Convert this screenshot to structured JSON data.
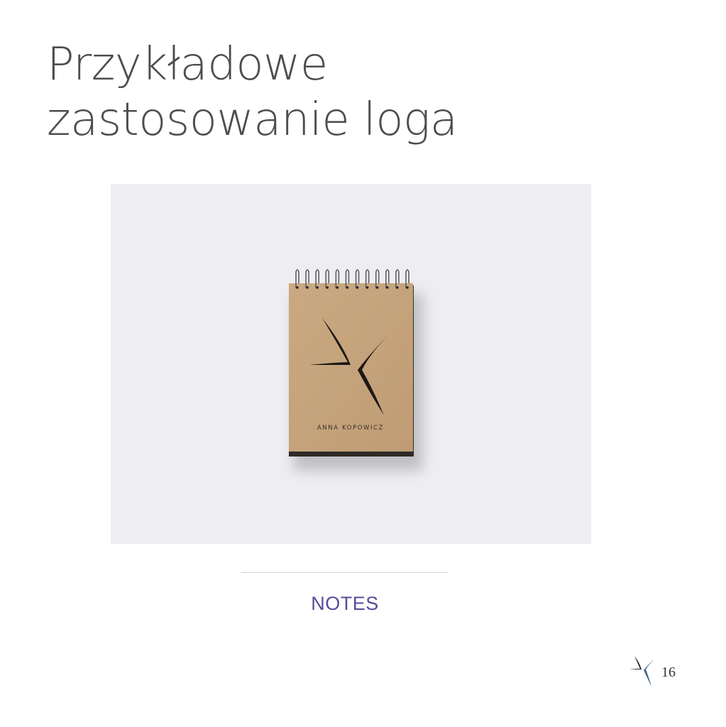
{
  "page": {
    "title": "Przykładowe zastosowanie loga",
    "caption": "NOTES",
    "page_number": "16"
  },
  "mockup": {
    "product": "spiral notepad",
    "brand_name": "ANNA KOPOWICZ",
    "logo_icon": "star-mark-icon",
    "cover_color": "#c6a47e",
    "background_color": "#eeeef0"
  },
  "footer": {
    "logo_icon": "star-mark-icon"
  },
  "colors": {
    "title": "#4d4d4d",
    "caption": "#5a4a9c",
    "rule": "#d4d4d8"
  }
}
